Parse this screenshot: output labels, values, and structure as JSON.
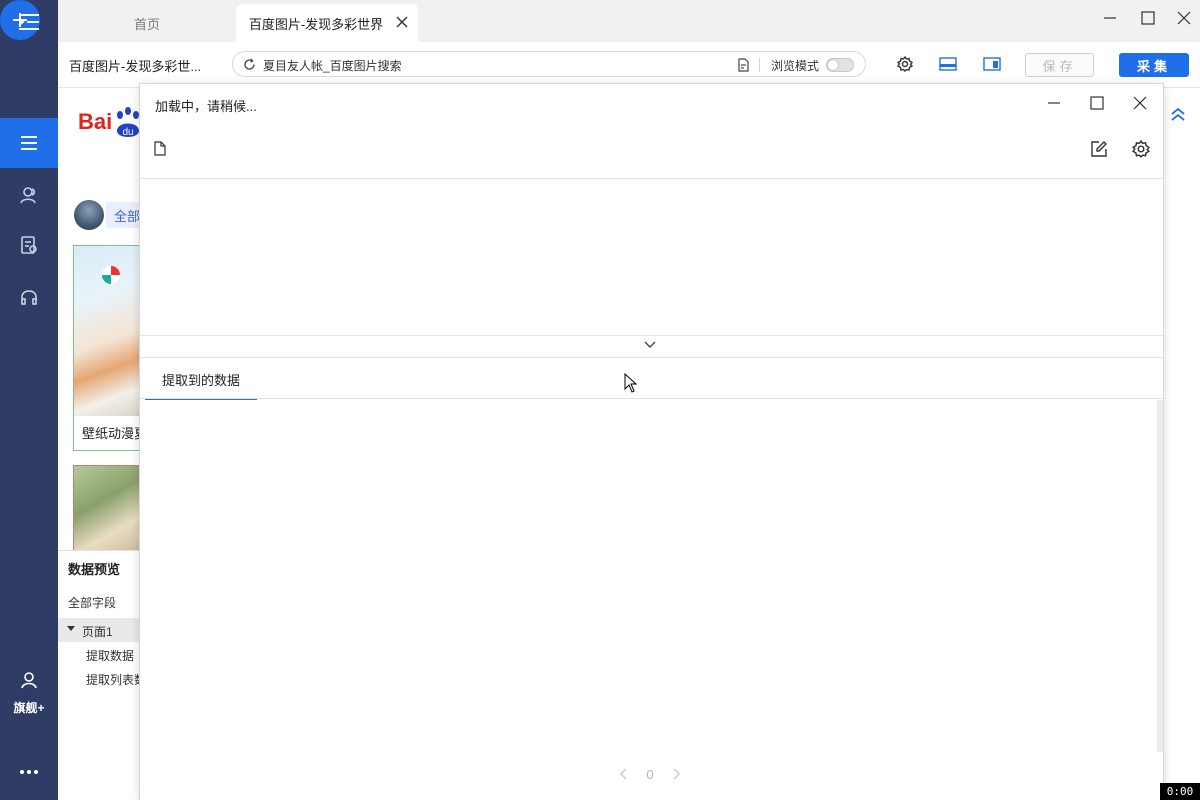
{
  "sidebar": {
    "vip_label": "旗舰+"
  },
  "tabs": {
    "home": "首页",
    "active": "百度图片-发现多彩世界"
  },
  "addressbar": {
    "page_title": "百度图片-发现多彩世...",
    "url": "夏目友人帐_百度图片搜索",
    "browse_mode_label": "浏览模式",
    "browse_mode_on": false,
    "save_label": "保存",
    "collect_label": "采集",
    "accent_color": "#1f6fe8"
  },
  "page": {
    "logo_text": "Bai",
    "all_label": "全部",
    "thumb1_caption": "壁纸动漫夏"
  },
  "preview": {
    "tab_label": "数据预览",
    "all_fields": "全部字段",
    "page1": "页面1",
    "extract_data": "提取数据",
    "extract_list": "提取列表数"
  },
  "dialog": {
    "title": "加载中，请稍候...",
    "tab_extracted": "提取到的数据",
    "pager_value": "0"
  },
  "timer": "0:00"
}
